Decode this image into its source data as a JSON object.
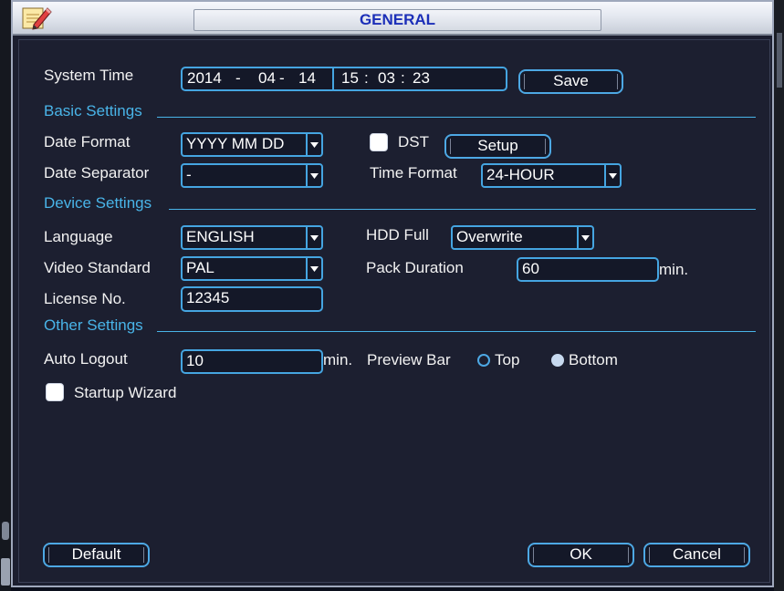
{
  "window": {
    "title": "GENERAL"
  },
  "system_time": {
    "label": "System Time",
    "year": "2014",
    "sep1": "-",
    "month": "04",
    "sep2": "-",
    "day": "14",
    "hour": "15",
    "sep3": ":",
    "minute": "03",
    "sep4": ":",
    "second": "23",
    "save_label": "Save"
  },
  "basic_settings": {
    "header": "Basic Settings",
    "date_format_label": "Date Format",
    "date_format_value": "YYYY MM DD",
    "dst_label": "DST",
    "dst_checked": false,
    "setup_label": "Setup",
    "date_separator_label": "Date Separator",
    "date_separator_value": "-",
    "time_format_label": "Time Format",
    "time_format_value": "24-HOUR"
  },
  "device_settings": {
    "header": "Device Settings",
    "language_label": "Language",
    "language_value": "ENGLISH",
    "hdd_full_label": "HDD Full",
    "hdd_full_value": "Overwrite",
    "video_standard_label": "Video Standard",
    "video_standard_value": "PAL",
    "pack_duration_label": "Pack Duration",
    "pack_duration_value": "60",
    "pack_duration_unit": "min.",
    "license_label": "License No.",
    "license_value": "12345"
  },
  "other_settings": {
    "header": "Other Settings",
    "auto_logout_label": "Auto Logout",
    "auto_logout_value": "10",
    "auto_logout_unit": "min.",
    "preview_bar_label": "Preview Bar",
    "preview_top_label": "Top",
    "preview_bottom_label": "Bottom",
    "preview_selected": "Bottom",
    "startup_wizard_label": "Startup Wizard",
    "startup_wizard_checked": false
  },
  "footer": {
    "default_label": "Default",
    "ok_label": "OK",
    "cancel_label": "Cancel"
  },
  "colors": {
    "accent": "#45a5e1",
    "section": "#49b4e8",
    "title_text": "#1c2fb8",
    "background": "#1c1f30"
  },
  "icons": {
    "app": "settings-pencil-icon",
    "dropdown": "chevron-down-icon"
  }
}
